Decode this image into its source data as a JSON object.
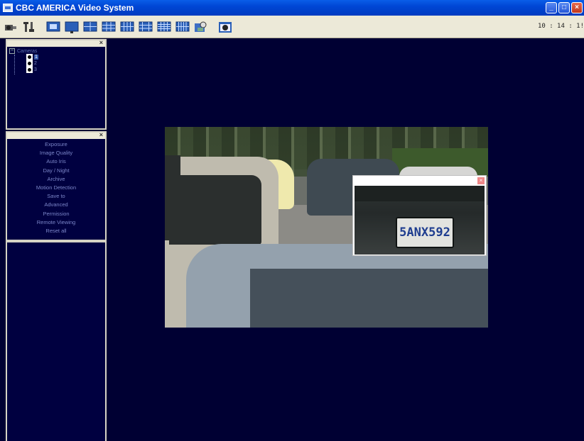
{
  "window": {
    "title": "CBC AMERICA Video System"
  },
  "toolbar": {
    "icons": [
      "camera-search",
      "tools",
      "single-view",
      "monitor",
      "quad-view",
      "split-view-9",
      "split-view-12",
      "split-view-13",
      "split-view-16",
      "split-view-20",
      "playback-search",
      "snapshot"
    ],
    "clock": "10 : 14 : 1!"
  },
  "camera_panel": {
    "root": "Cameras",
    "cameras": [
      "1",
      "2",
      "3"
    ],
    "selected": "1"
  },
  "settings_menu": {
    "items": [
      "Exposure",
      "Image Quality",
      "Auto Iris",
      "Day / Night",
      "Archive",
      "Motion Detection",
      "Save to",
      "Advanced",
      "Permission",
      "Remote Viewing",
      "Reset all"
    ]
  },
  "video": {
    "zoom_plate": "5ANX592"
  },
  "colors": {
    "background": "#000033",
    "titlebar": "#0046d5",
    "panel_text": "#7b86c8"
  }
}
